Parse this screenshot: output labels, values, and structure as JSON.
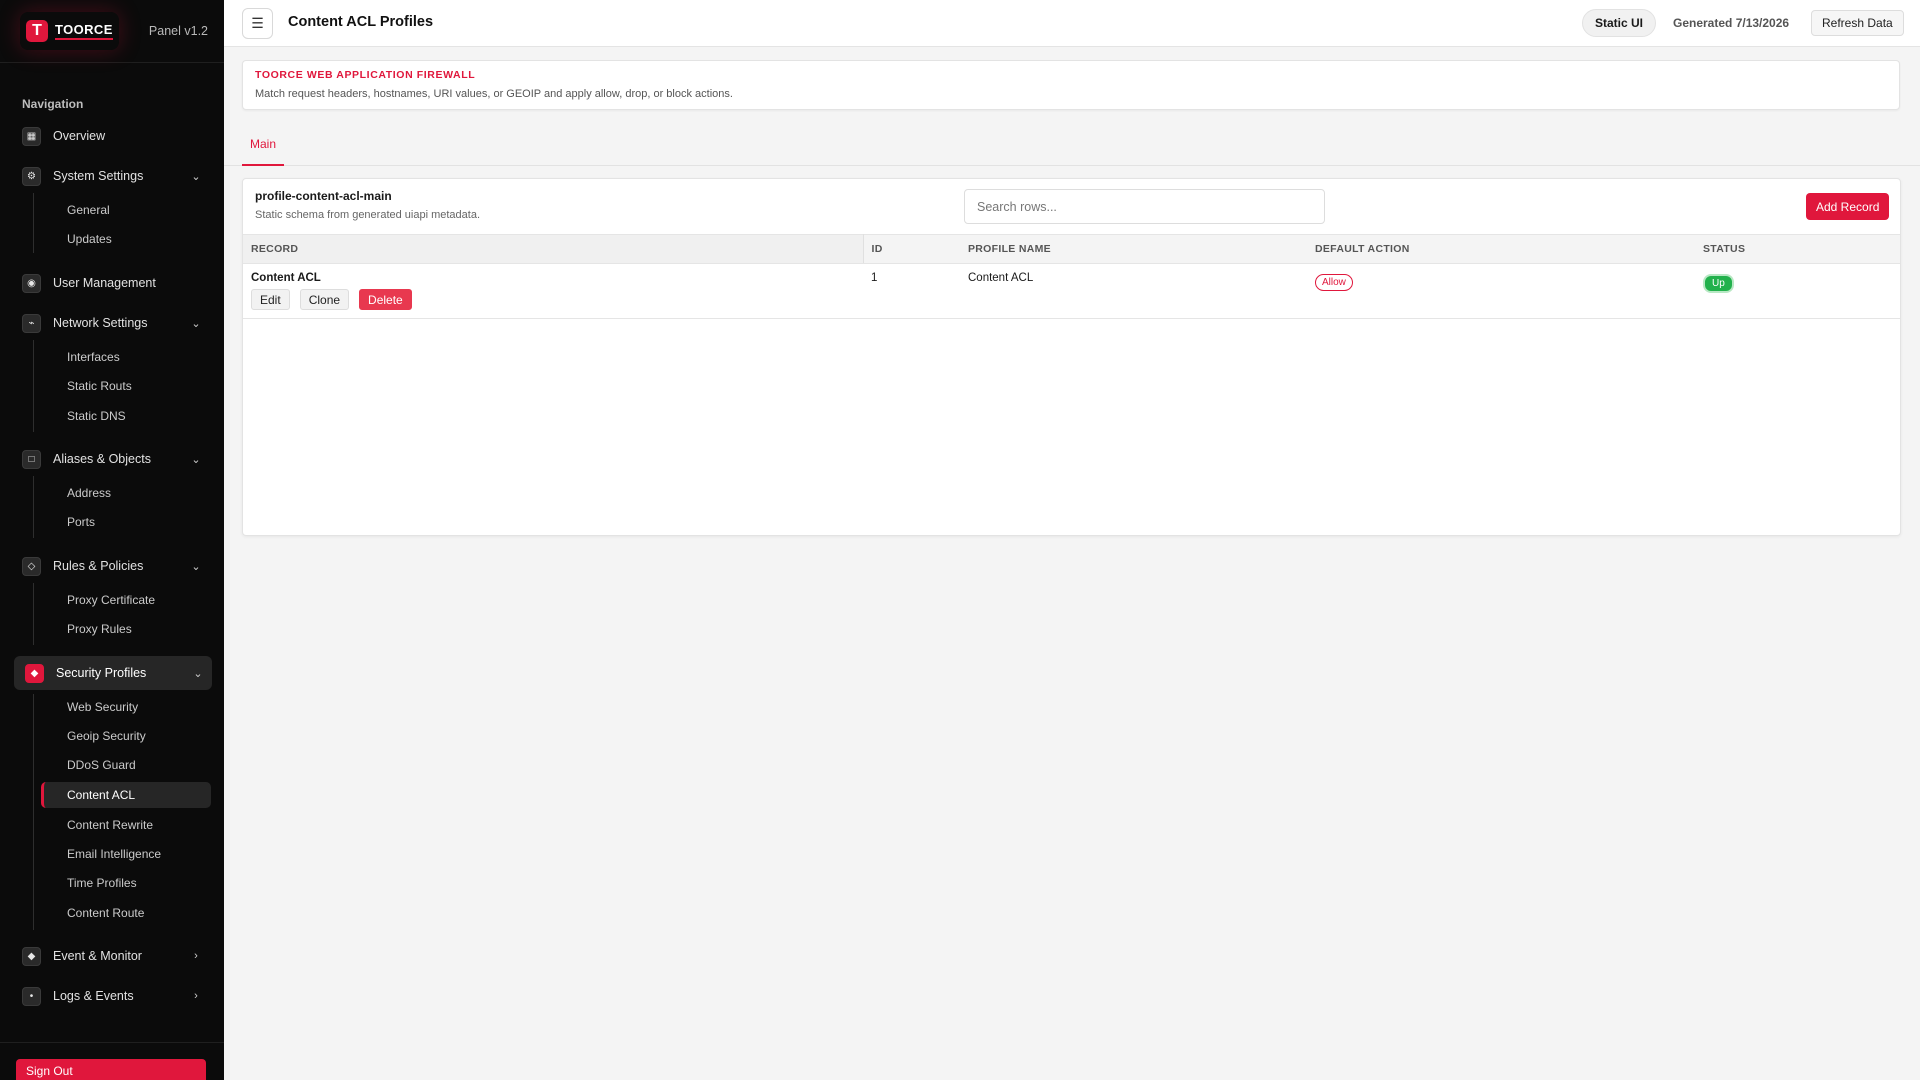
{
  "brand": {
    "logo_letter": "T",
    "name": "TOORCE",
    "version": "Panel v1.2"
  },
  "sidebar": {
    "heading": "Navigation",
    "groups": [
      {
        "label": "Overview",
        "icon": "grid-icon"
      },
      {
        "label": "System Settings",
        "icon": "gear-icon",
        "expanded": true,
        "items": [
          "General",
          "Updates"
        ]
      },
      {
        "label": "User Management",
        "icon": "user-icon"
      },
      {
        "label": "Network Settings",
        "icon": "network-icon",
        "expanded": true,
        "items": [
          "Interfaces",
          "Static Routs",
          "Static DNS"
        ]
      },
      {
        "label": "Aliases & Objects",
        "icon": "box-icon",
        "expanded": true,
        "items": [
          "Address",
          "Ports"
        ]
      },
      {
        "label": "Rules & Policies",
        "icon": "diamond-icon",
        "expanded": true,
        "items": [
          "Proxy Certificate",
          "Proxy Rules"
        ]
      },
      {
        "label": "Security Profiles",
        "icon": "shield-icon",
        "expanded": true,
        "active": true,
        "items": [
          "Web Security",
          "Geoip Security",
          "DDoS Guard",
          "Content ACL",
          "Content Rewrite",
          "Email Intelligence",
          "Time Profiles",
          "Content Route"
        ],
        "active_item": "Content ACL"
      },
      {
        "label": "Event & Monitor",
        "icon": "monitor-icon"
      },
      {
        "label": "Logs & Events",
        "icon": "dot-icon"
      }
    ],
    "signout_label": "Sign Out"
  },
  "topbar": {
    "menu_glyph": "☰",
    "title": "Content ACL Profiles",
    "static_chip": "Static UI",
    "generated": "Generated 7/13/2026",
    "refresh_label": "Refresh Data"
  },
  "banner": {
    "title": "TOORCE WEB APPLICATION FIREWALL",
    "description": "Match request headers, hostnames, URI values, or GEOIP and apply allow, drop, or block actions."
  },
  "tabs": [
    {
      "label": "Main",
      "active": true
    }
  ],
  "panel": {
    "title": "profile-content-acl-main",
    "subtitle": "Static schema from generated uiapi metadata.",
    "search_placeholder": "Search rows...",
    "add_label": "Add Record",
    "columns": [
      "RECORD",
      "ID",
      "PROFILE NAME",
      "DEFAULT ACTION",
      "STATUS"
    ],
    "rows": [
      {
        "record": "Content ACL",
        "id": "1",
        "profile_name": "Content ACL",
        "default_action": "Allow",
        "status": "Up",
        "actions": {
          "edit": "Edit",
          "clone": "Clone",
          "delete": "Delete"
        }
      }
    ]
  },
  "colors": {
    "accent": "#e0173c",
    "success": "#22b14c",
    "sidebar_bg": "#0b0b0b"
  }
}
